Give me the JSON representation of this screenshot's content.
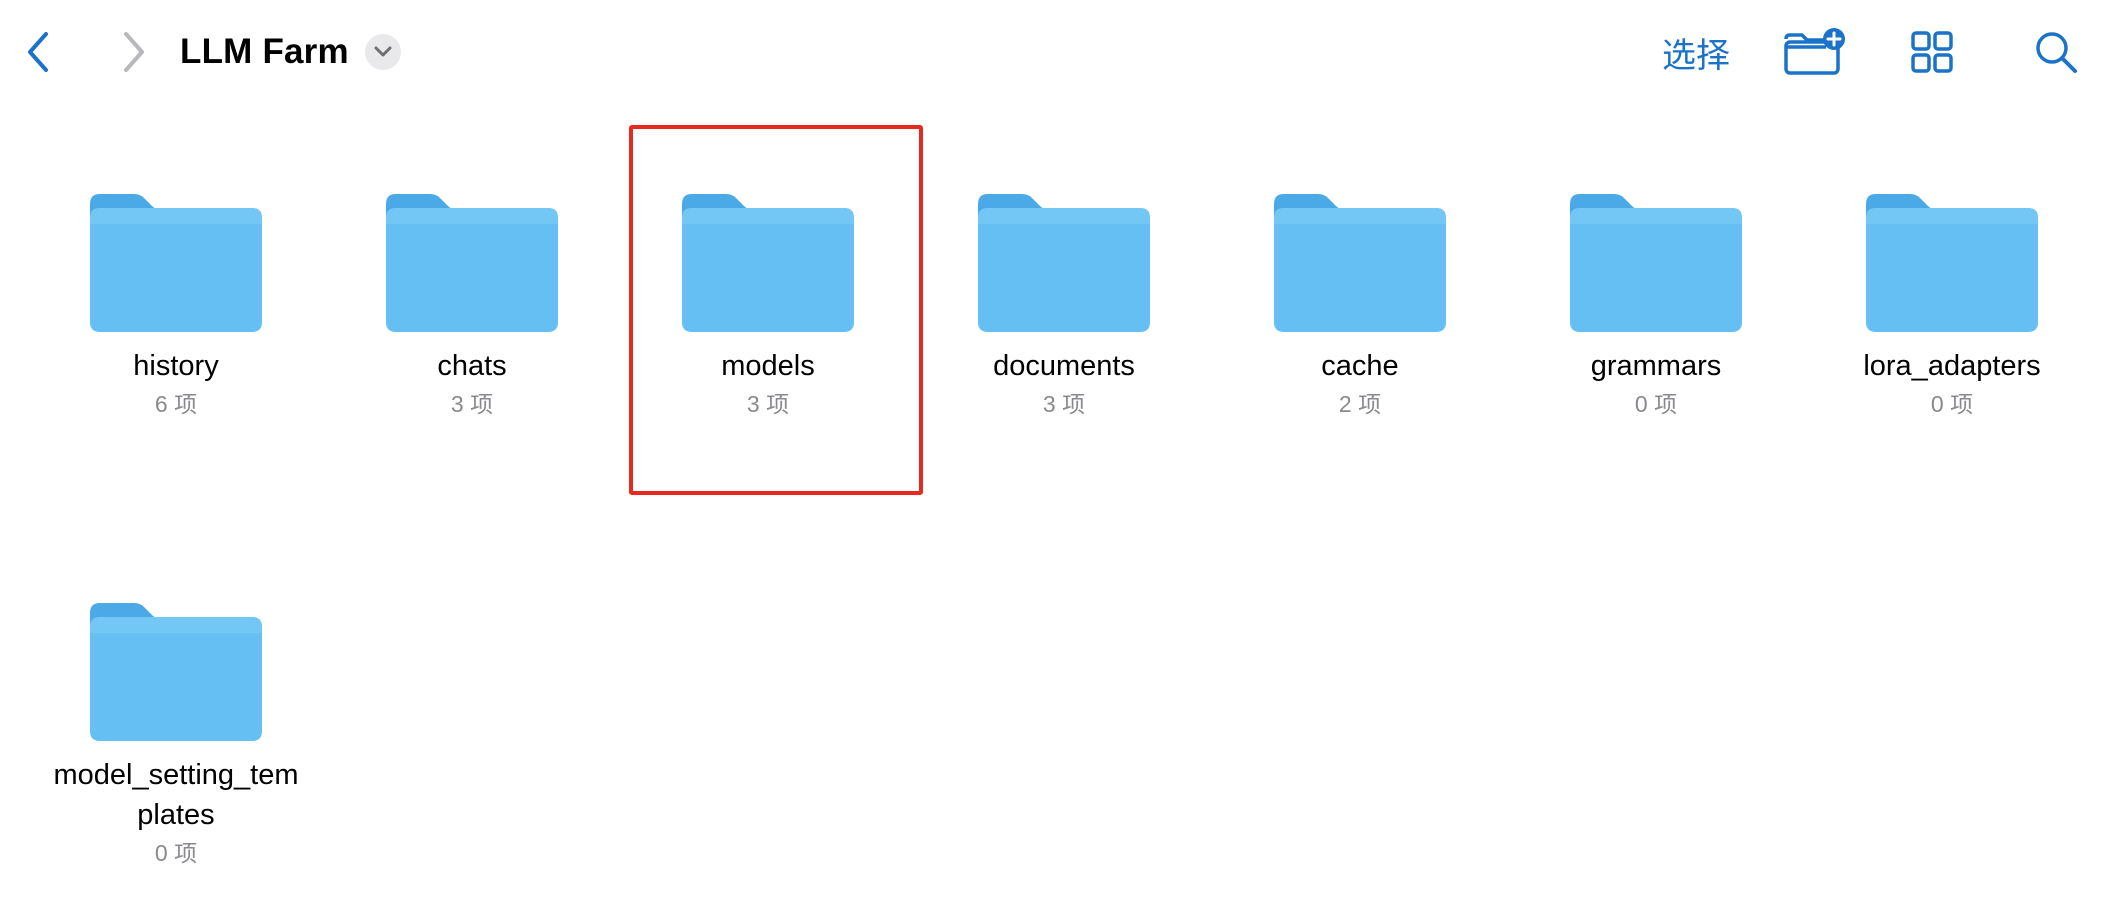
{
  "header": {
    "title": "LLM Farm",
    "select_label": "选择"
  },
  "icons": {
    "back": "chevron-left-icon",
    "forward": "chevron-right-icon",
    "title_menu": "chevron-down-icon",
    "new_folder": "folder-plus-icon",
    "view_grid": "grid-icon",
    "search": "search-icon",
    "folder": "folder-icon"
  },
  "colors": {
    "accent": "#1a73c9",
    "folder_top": "#4aa9e6",
    "folder_front": "#67c0f2",
    "highlight": "#e8291f",
    "secondary_text": "#8a8a8e"
  },
  "folders": [
    {
      "name": "history",
      "count": "6 项"
    },
    {
      "name": "chats",
      "count": "3 项"
    },
    {
      "name": "models",
      "count": "3 项",
      "highlighted": true
    },
    {
      "name": "documents",
      "count": "3 项"
    },
    {
      "name": "cache",
      "count": "2 项"
    },
    {
      "name": "grammars",
      "count": "0 项"
    },
    {
      "name": "lora_adapters",
      "count": "0 项"
    },
    {
      "name": "model_setting_templates",
      "count": "0 项"
    }
  ]
}
